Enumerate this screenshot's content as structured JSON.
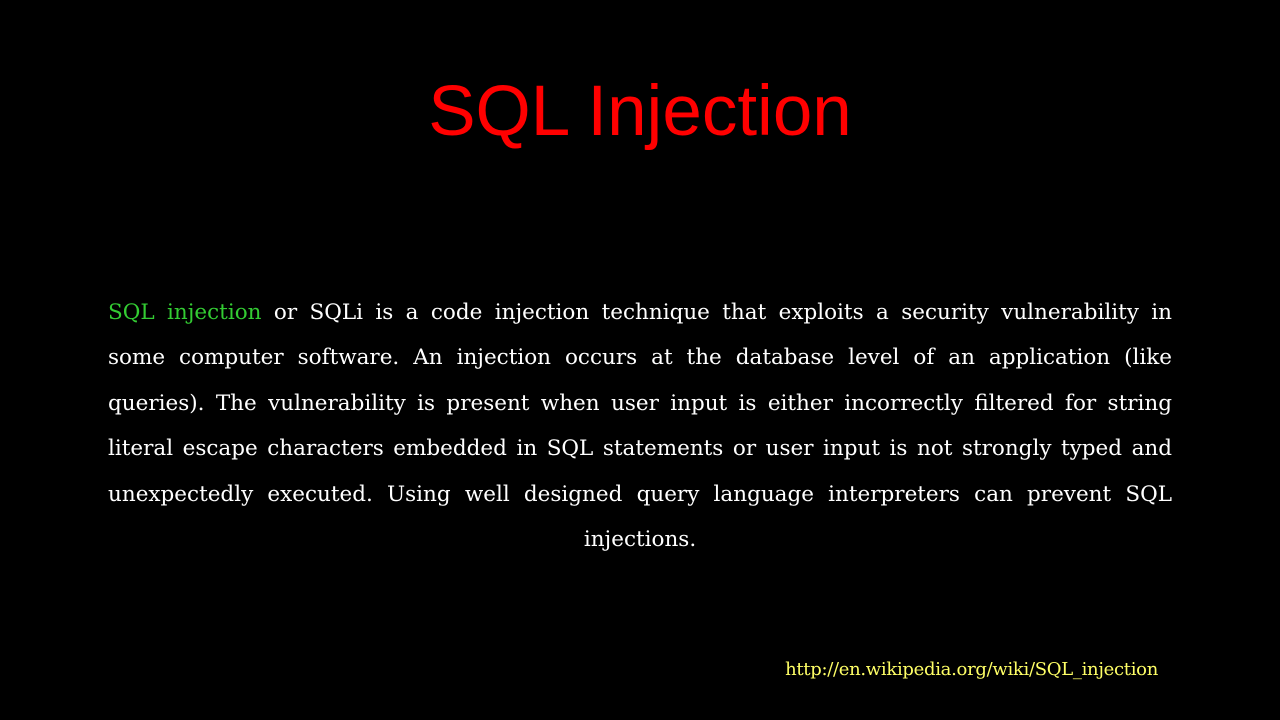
{
  "slide": {
    "title": "SQL Injection",
    "body": {
      "highlight": "SQL injection",
      "text": " or SQLi is a code injection technique that exploits a security vulnerability in some computer software. An injection occurs at the database level of an application (like queries). The vulnerability is present when user input is either incorrectly filtered for string literal escape characters embedded in SQL statements or user input is not strongly typed and unexpectedly executed. Using well designed query language interpreters can prevent SQL injections."
    },
    "source_link": "http://en.wikipedia.org/wiki/SQL_injection"
  },
  "colors": {
    "background": "#000000",
    "title": "#ff0000",
    "highlight": "#33cc33",
    "body_text": "#ffffff",
    "link": "#ffff66"
  }
}
